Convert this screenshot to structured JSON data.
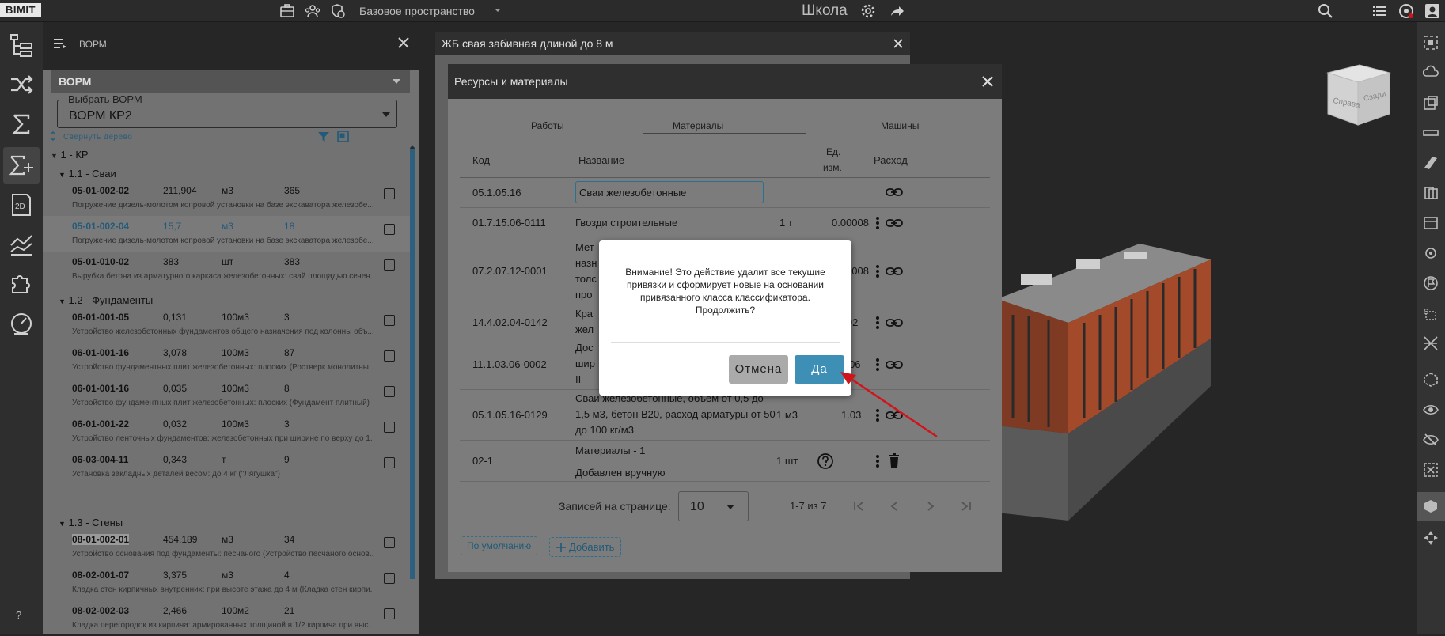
{
  "topbar": {
    "logo": "BIMIT",
    "space_name": "Базовое пространство",
    "project_title": "Школа"
  },
  "ledger": {
    "header_title": "ВОРМ",
    "section_label": "ВОРМ",
    "select_label": "Выбрать ВОРМ",
    "select_value": "ВОРМ КР2",
    "collapse_label": "Свернуть дерево",
    "tree": {
      "root": "1 - КР",
      "groups": [
        {
          "title": "1.1 - Сваи"
        },
        {
          "title": "1.2 - Фундаменты"
        },
        {
          "title": "1.3 - Стены"
        }
      ],
      "rows": [
        {
          "code": "05-01-002-02",
          "qty": "211,904",
          "unit": "м3",
          "n": "365",
          "desc": "Погружение дизель-молотом копровой установки на базе экскаватора железобе..."
        },
        {
          "code": "05-01-002-04",
          "qty": "15,7",
          "unit": "м3",
          "n": "18",
          "desc": "Погружение дизель-молотом копровой установки на базе экскаватора железобе..."
        },
        {
          "code": "05-01-010-02",
          "qty": "383",
          "unit": "шт",
          "n": "383",
          "desc": "Вырубка бетона из арматурного каркаса железобетонных: свай площадью сечен..."
        },
        {
          "code": "06-01-001-05",
          "qty": "0,131",
          "unit": "100м3",
          "n": "3",
          "desc": "Устройство железобетонных фундаментов общего назначения под колонны объ..."
        },
        {
          "code": "06-01-001-16",
          "qty": "3,078",
          "unit": "100м3",
          "n": "87",
          "desc": "Устройство фундаментных плит железобетонных: плоских (Ростверк монолитны..."
        },
        {
          "code": "06-01-001-16",
          "qty": "0,035",
          "unit": "100м3",
          "n": "8",
          "desc": "Устройство фундаментных плит железобетонных: плоских (Фундамент плитный)"
        },
        {
          "code": "06-01-001-22",
          "qty": "0,032",
          "unit": "100м3",
          "n": "3",
          "desc": "Устройство ленточных фундаментов: железобетонных при ширине по верху до 1..."
        },
        {
          "code": "06-03-004-11",
          "qty": "0,343",
          "unit": "т",
          "n": "9",
          "desc": "Установка закладных деталей весом: до 4 кг (\"Лягушка\")"
        },
        {
          "code": "08-01-002-01",
          "qty": "454,189",
          "unit": "м3",
          "n": "34",
          "desc": "Устройство основания под фундаменты: песчаного (Устройство песчаного основ..."
        },
        {
          "code": "08-02-001-07",
          "qty": "3,375",
          "unit": "м3",
          "n": "4",
          "desc": "Кладка стен кирпичных внутренних: при высоте этажа до 4 м (Кладка стен кирпи..."
        },
        {
          "code": "08-02-002-03",
          "qty": "2,466",
          "unit": "100м2",
          "n": "21",
          "desc": "Кладка перегородок из кирпича: армированных толщиной в 1/2 кирпича при выс..."
        }
      ]
    }
  },
  "back_dialog": {
    "title": "ЖБ свая забивная длиной до 8 м"
  },
  "dialog": {
    "title": "Ресурсы и материалы",
    "tabs": [
      "Работы",
      "Материалы",
      "Машины"
    ],
    "columns": {
      "code": "Код",
      "name": "Название",
      "unit_1": "Ед.",
      "unit_2": "изм.",
      "rate": "Расход"
    },
    "rows": [
      {
        "code": "05.1.05.16",
        "name": "Сваи железобетонные",
        "unit": "",
        "rate": ""
      },
      {
        "code": "01.7.15.06-0111",
        "name": "Гвозди строительные",
        "unit": "1 т",
        "rate": "0.00008"
      },
      {
        "code": "07.2.07.12-0001",
        "name_lines": [
          "Мет",
          "назн",
          "толс",
          "про"
        ],
        "unit": "",
        "rate": "0.00008"
      },
      {
        "code": "14.4.02.04-0142",
        "name_lines": [
          "Кра",
          "жел"
        ],
        "unit": "",
        "rate": "0.02"
      },
      {
        "code": "11.1.03.06-0002",
        "name_lines": [
          "Дос",
          "шир",
          "II"
        ],
        "unit": "",
        "rate": "0.006"
      },
      {
        "code": "05.1.05.16-0129",
        "name_lines": [
          "Сваи железобетонные, объем от 0,5 до",
          "1,5 м3, бетон B20, расход арматуры от 50",
          "до 100 кг/м3"
        ],
        "unit": "1 м3",
        "rate": "1.03"
      },
      {
        "code": "02-1",
        "name_lines": [
          "Материалы - 1",
          "Добавлен вручную"
        ],
        "unit": "1 шт",
        "rate": ""
      }
    ],
    "pagination": {
      "label": "Записей на странице:",
      "per_page": "10",
      "range": "1-7 из 7"
    },
    "buttons": {
      "default": "По умолчанию",
      "add": "Добавить"
    }
  },
  "modal": {
    "text": "Внимание! Это действие удалит все текущие привязки и сформирует новые на основании привязанного класса классификатора. Продолжить?",
    "cancel": "Отмена",
    "confirm": "Да"
  },
  "viewport": {
    "cube_front": "Справа",
    "cube_side": "Сзади"
  },
  "colors": {
    "accent": "#3d8fb6",
    "confirm_button": "#3d8fb6",
    "cancel_button": "#aaaaaa",
    "annotation_arrow": "#d0141c"
  }
}
